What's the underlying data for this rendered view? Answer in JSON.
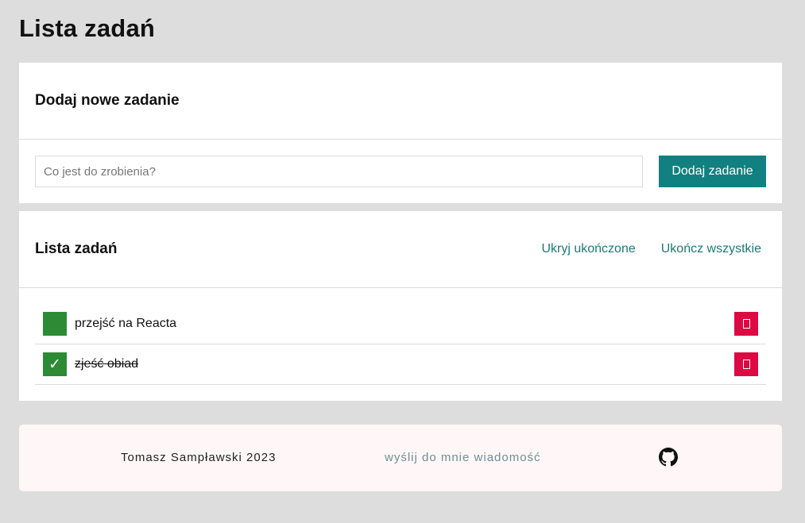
{
  "page": {
    "title": "Lista zadań"
  },
  "add_section": {
    "title": "Dodaj nowe zadanie",
    "input_placeholder": "Co jest do zrobienia?",
    "input_value": "",
    "button_label": "Dodaj zadanie"
  },
  "list_section": {
    "title": "Lista zadań",
    "hide_done_label": "Ukryj ukończone",
    "complete_all_label": "Ukończ wszystkie",
    "tasks": [
      {
        "text": "przejść na Reacta",
        "done": false,
        "check_mark": ""
      },
      {
        "text": "zjeść obiad",
        "done": true,
        "check_mark": "✓"
      }
    ]
  },
  "footer": {
    "author": "Tomasz Sampławski 2023",
    "contact_link": "wyślij do mnie wiadomość",
    "github_icon": "github-icon"
  },
  "colors": {
    "background": "#dddddd",
    "accent": "#118080",
    "checkbox": "#2e8b35",
    "delete": "#dc0a43",
    "link": "#1a7a76",
    "footer_bg": "#fff7f7"
  }
}
